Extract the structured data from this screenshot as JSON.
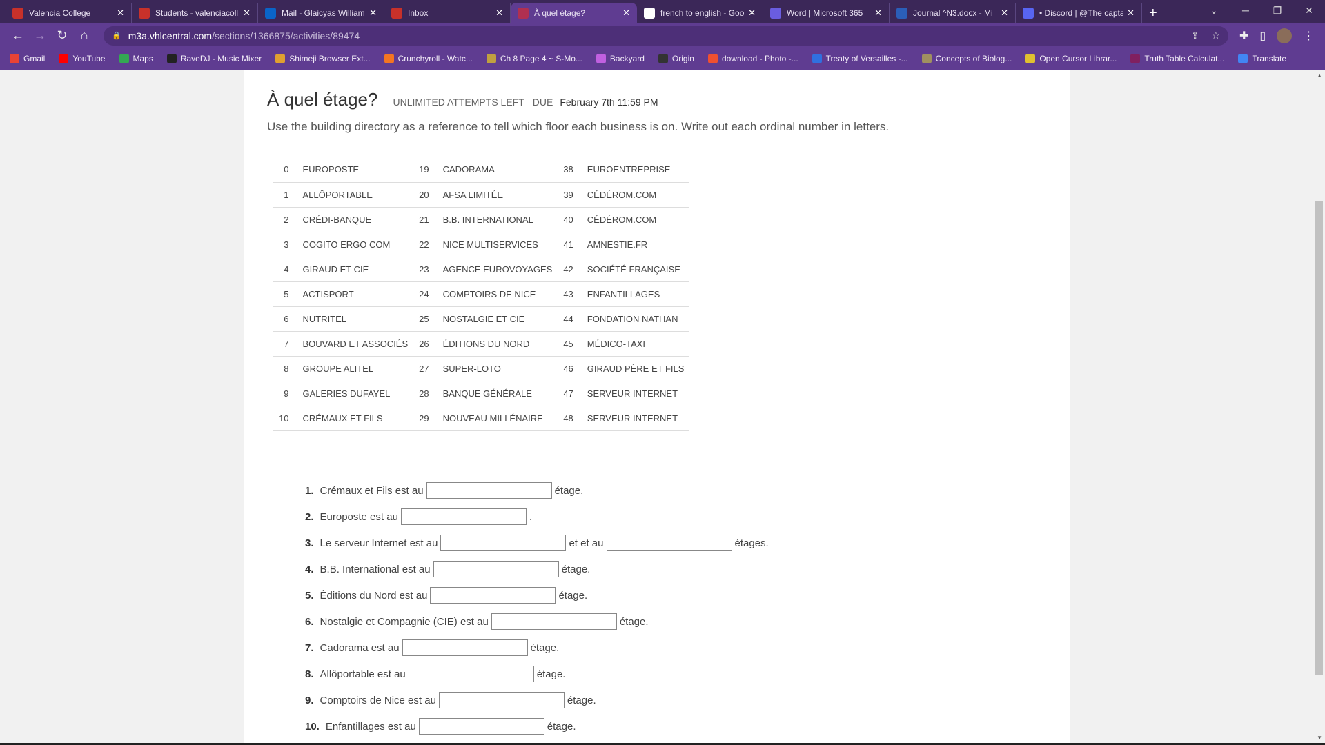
{
  "browser": {
    "tabs": [
      {
        "title": "Valencia College",
        "icon": "valencia-icon",
        "color": "#c8312a"
      },
      {
        "title": "Students - valenciacoll",
        "icon": "valencia-icon",
        "color": "#c8312a"
      },
      {
        "title": "Mail - Glaicyas William",
        "icon": "outlook-icon",
        "color": "#0a64c8"
      },
      {
        "title": "Inbox",
        "icon": "valencia-icon",
        "color": "#c8312a"
      },
      {
        "title": "À quel étage?",
        "icon": "vhl-icon",
        "color": "#b03050",
        "active": true
      },
      {
        "title": "french to english - Goo",
        "icon": "google-icon",
        "color": "#ffffff"
      },
      {
        "title": "Word | Microsoft 365",
        "icon": "microsoft-365-icon",
        "color": "#6a5de0"
      },
      {
        "title": "Journal ^N3.docx - Mi",
        "icon": "word-icon",
        "color": "#2b5eb8"
      },
      {
        "title": "• Discord | @The capta",
        "icon": "discord-icon",
        "color": "#5865f2"
      }
    ],
    "url_host": "m3a.vhlcentral.com",
    "url_path": "/sections/1366875/activities/89474",
    "bookmarks": [
      {
        "label": "Gmail",
        "color": "#ea4335"
      },
      {
        "label": "YouTube",
        "color": "#ff0000"
      },
      {
        "label": "Maps",
        "color": "#34a853"
      },
      {
        "label": "RaveDJ - Music Mixer",
        "color": "#222222"
      },
      {
        "label": "Shimeji Browser Ext...",
        "color": "#e0a030"
      },
      {
        "label": "Crunchyroll - Watc...",
        "color": "#f47521"
      },
      {
        "label": "Ch 8 Page 4 ~ S-Mo...",
        "color": "#c0a040"
      },
      {
        "label": "Backyard",
        "color": "#c060e0"
      },
      {
        "label": "Origin",
        "color": "#333333"
      },
      {
        "label": "download - Photo -...",
        "color": "#f05030"
      },
      {
        "label": "Treaty of Versailles -...",
        "color": "#3070e0"
      },
      {
        "label": "Concepts of Biolog...",
        "color": "#a09060"
      },
      {
        "label": "Open Cursor Librar...",
        "color": "#e0c030"
      },
      {
        "label": "Truth Table Calculat...",
        "color": "#802060"
      },
      {
        "label": "Translate",
        "color": "#4285f4"
      }
    ]
  },
  "activity": {
    "title": "À quel étage?",
    "attempts": "UNLIMITED ATTEMPTS LEFT",
    "due_label": "DUE",
    "due_date": "February 7th 11:59 PM",
    "instructions": "Use the building directory as a reference to tell which floor each business is on. Write out each ordinal number in letters."
  },
  "directory": [
    [
      [
        "0",
        "EUROPOSTE"
      ],
      [
        "19",
        "CADORAMA"
      ],
      [
        "38",
        "EUROENTREPRISE"
      ]
    ],
    [
      [
        "1",
        "ALLÔPORTABLE"
      ],
      [
        "20",
        "AFSA LIMITÉE"
      ],
      [
        "39",
        "CÉDÉROM.COM"
      ]
    ],
    [
      [
        "2",
        "CRÉDI-BANQUE"
      ],
      [
        "21",
        "B.B. INTERNATIONAL"
      ],
      [
        "40",
        "CÉDÉROM.COM"
      ]
    ],
    [
      [
        "3",
        "COGITO ERGO COM"
      ],
      [
        "22",
        "NICE MULTISERVICES"
      ],
      [
        "41",
        "AMNESTIE.FR"
      ]
    ],
    [
      [
        "4",
        "GIRAUD ET CIE"
      ],
      [
        "23",
        "AGENCE EUROVOYAGES"
      ],
      [
        "42",
        "SOCIÉTÉ FRANÇAISE"
      ]
    ],
    [
      [
        "5",
        "ACTISPORT"
      ],
      [
        "24",
        "COMPTOIRS DE NICE"
      ],
      [
        "43",
        "ENFANTILLAGES"
      ]
    ],
    [
      [
        "6",
        "NUTRITEL"
      ],
      [
        "25",
        "NOSTALGIE ET CIE"
      ],
      [
        "44",
        "FONDATION NATHAN"
      ]
    ],
    [
      [
        "7",
        "BOUVARD ET ASSOCIÉS"
      ],
      [
        "26",
        "ÉDITIONS DU NORD"
      ],
      [
        "45",
        "MÉDICO-TAXI"
      ]
    ],
    [
      [
        "8",
        "GROUPE ALITEL"
      ],
      [
        "27",
        "SUPER-LOTO"
      ],
      [
        "46",
        "GIRAUD PÈRE ET FILS"
      ]
    ],
    [
      [
        "9",
        "GALERIES DUFAYEL"
      ],
      [
        "28",
        "BANQUE GÉNÉRALE"
      ],
      [
        "47",
        "SERVEUR INTERNET"
      ]
    ],
    [
      [
        "10",
        "CRÉMAUX ET FILS"
      ],
      [
        "29",
        "NOUVEAU MILLÉNAIRE"
      ],
      [
        "48",
        "SERVEUR INTERNET"
      ]
    ]
  ],
  "questions": [
    {
      "num": "1.",
      "parts": [
        "Crémaux et Fils est au",
        "étage."
      ],
      "value": ""
    },
    {
      "num": "2.",
      "parts": [
        "Europoste est au",
        "."
      ],
      "value": ""
    },
    {
      "num": "3.",
      "parts": [
        "Le serveur Internet est au",
        "et et au",
        "étages."
      ],
      "value": ""
    },
    {
      "num": "4.",
      "parts": [
        "B.B. International est au",
        "étage."
      ],
      "value": ""
    },
    {
      "num": "5.",
      "parts": [
        "Éditions du Nord est au",
        "étage."
      ],
      "value": ""
    },
    {
      "num": "6.",
      "parts": [
        "Nostalgie et Compagnie (CIE) est au",
        "étage."
      ],
      "value": ""
    },
    {
      "num": "7.",
      "parts": [
        "Cadorama est au",
        "étage."
      ],
      "value": ""
    },
    {
      "num": "8.",
      "parts": [
        "Allôportable est au",
        "étage."
      ],
      "value": ""
    },
    {
      "num": "9.",
      "parts": [
        "Comptoirs de Nice est au",
        "étage."
      ],
      "value": ""
    },
    {
      "num": "10.",
      "parts": [
        "Enfantillages est au",
        "étage."
      ],
      "value": ""
    }
  ]
}
